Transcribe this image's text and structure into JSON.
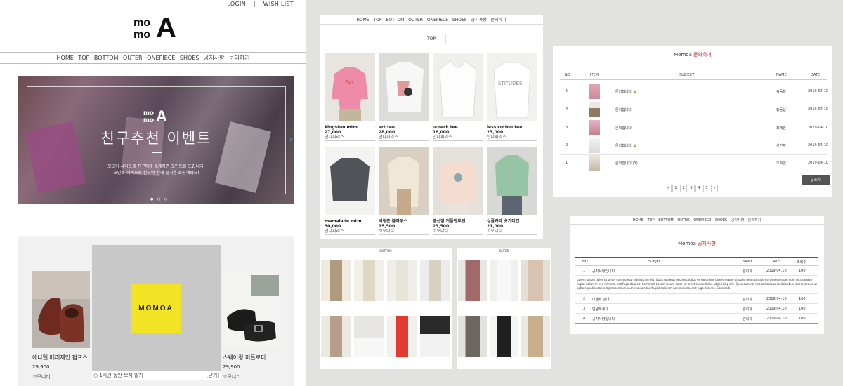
{
  "main": {
    "top_links": [
      "LOGIN",
      "|",
      "WISH LIST"
    ],
    "logo": {
      "line1": "mo",
      "line2": "mo",
      "letter": "A"
    },
    "nav": [
      "HOME",
      "TOP",
      "BOTTOM",
      "OUTER",
      "ONEPIECE",
      "SHOES",
      "공지사항",
      "문의하기"
    ],
    "hero": {
      "title": "친구추천 이벤트",
      "desc_line1": "모모아 사이트를 친구에게 소개하면 포인트를 드립니다!",
      "desc_line2": "포인트 혜택으로 친구와 함께 즐거운 쇼핑해봐요!",
      "arrow": "›",
      "dots": "● ○ ○"
    },
    "products": [
      {
        "name": "에나멜 메리제인 펌프스",
        "price": "29,900",
        "brand": "코모디티"
      },
      {
        "name": "스퀘어링 미들로퍼",
        "price": "29,900",
        "brand": "코모디티"
      }
    ],
    "popup": {
      "logo_text": "MOMOA",
      "dont_show": "○ 1시간 동안 보지 않기",
      "close": "[닫기]"
    }
  },
  "top_page": {
    "nav": [
      "HOME",
      "TOP",
      "BOTTOM",
      "OUTER",
      "ONEPIECE",
      "SHOES",
      "공지사항",
      "문의하기"
    ],
    "category": "TOP",
    "items": [
      {
        "name": "kingston mtm",
        "price": "27,000",
        "brand": "안나파리스"
      },
      {
        "name": "art tee",
        "price": "28,000",
        "brand": "안나파리스"
      },
      {
        "name": "u-neck tee",
        "price": "18,000",
        "brand": "안나파리스"
      },
      {
        "name": "less cotton tee",
        "price": "23,000",
        "brand": "안나파리스"
      },
      {
        "name": "mamalade mtm",
        "price": "30,000",
        "brand": "안나파리스"
      },
      {
        "name": "셔링폰 블라우스",
        "price": "15,500",
        "brand": "코모디티"
      },
      {
        "name": "풍선껌 커플맨투맨",
        "price": "23,500",
        "brand": "코모디티"
      },
      {
        "name": "심플카라 숏가디건",
        "price": "21,000",
        "brand": "코모디티"
      }
    ]
  },
  "qna": {
    "title_prefix": "Momoa",
    "title_red": "문의하기",
    "headers": [
      "NO",
      "ITEM",
      "SUBJECT",
      "NAME",
      "DATE"
    ],
    "rows": [
      {
        "no": "5",
        "subject": "문의합니다 🔒",
        "name": "김동형",
        "date": "2019-04-10"
      },
      {
        "no": "4",
        "subject": "문의합니다",
        "name": "홍동섭",
        "date": "2019-04-10"
      },
      {
        "no": "3",
        "subject": "문의합니다",
        "name": "최혜원",
        "date": "2019-04-10"
      },
      {
        "no": "2",
        "subject": "문의합니다 🔒",
        "name": "서진지",
        "date": "2019-04-10"
      },
      {
        "no": "1",
        "subject": "문의합니다 (1)",
        "name": "조석인",
        "date": "2019-04-10"
      }
    ],
    "pager": [
      "«",
      "1",
      "2",
      "3",
      "4",
      "5",
      "»"
    ],
    "write_button": "글쓰기"
  },
  "bottom_page": {
    "category": "BOTTOM"
  },
  "outer_page": {
    "category": "OUTER"
  },
  "notice": {
    "nav": [
      "HOME",
      "TOP",
      "BOTTOM",
      "OUTER",
      "ONEPIECE",
      "SHOES",
      "공지사항",
      "문의하기"
    ],
    "title_prefix": "Momoa",
    "title_red": "공지사항",
    "headers": [
      "NO",
      "SUBJECT",
      "NAME",
      "DATE",
      "조회수"
    ],
    "rows": [
      {
        "no": "1",
        "subject": "공지사항입니다",
        "name": "관리자",
        "date": "2019.04.10",
        "views": "100"
      },
      {
        "no": "2",
        "subject": "이벤트 안내",
        "name": "관리자",
        "date": "2019.04.10",
        "views": "100"
      },
      {
        "no": "3",
        "subject": "안녕하세요",
        "name": "관리자",
        "date": "2019.04.10",
        "views": "100"
      },
      {
        "no": "4",
        "subject": "공지사항입니다",
        "name": "관리자",
        "date": "2019.04.10",
        "views": "100"
      }
    ],
    "lorem": "Lorem ipsum dolor sit amet consectetur adipisicing elit. Quos quaerat necessitatibus ex doloribus facere neque ut optio repudiandae est praesentium eum recusandae fugiat dolorem non minima, sed fuga dolores. Commodi Lorem ipsum dolor sit amet consectetur adipisicing elit. Quos quaerat necessitatibus ex doloribus facere neque ut optio repudiandae est praesentium eum recusandae fugiat dolorem non minima, sed fuga dolores. Commodi."
  },
  "colors": {
    "accent_red": "#c03030",
    "popup_yellow": "#f3e325",
    "page_bg": "#e2e2e0"
  }
}
